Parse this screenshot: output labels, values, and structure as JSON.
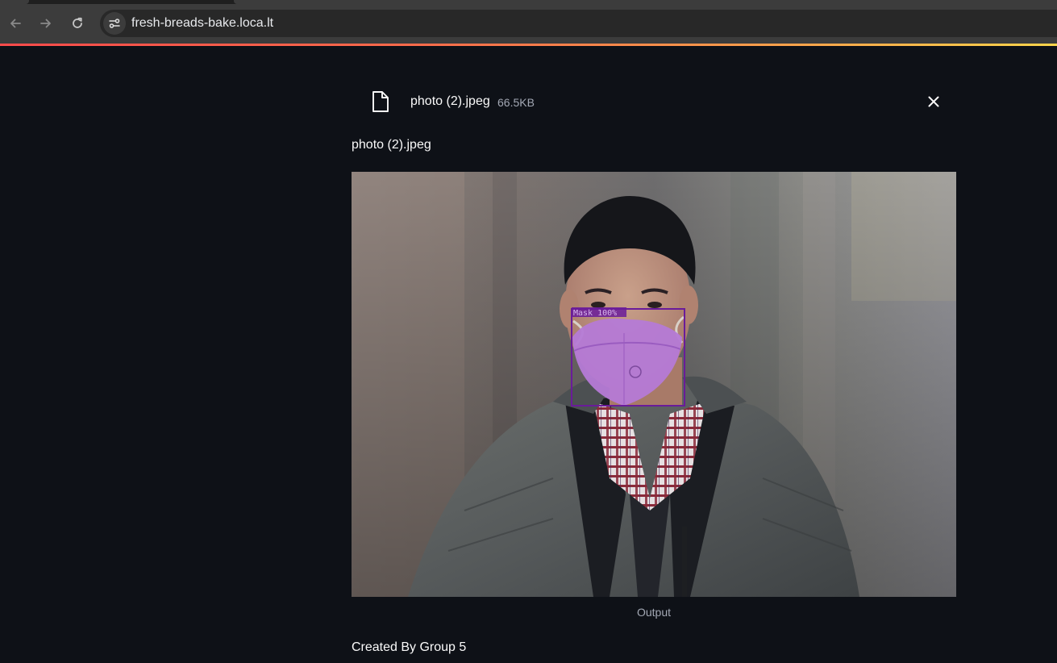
{
  "browser": {
    "url": "fresh-breads-bake.loca.lt"
  },
  "upload": {
    "file_name": "photo (2).jpeg",
    "file_size": "66.5KB"
  },
  "image_block": {
    "label": "photo (2).jpeg",
    "detection_label": "Mask 100%",
    "caption": "Output"
  },
  "footer": {
    "text": "Created By Group 5"
  },
  "colors": {
    "background": "#0e1117",
    "detection_box": "#6a1b9a",
    "mask_fill": "#b57ad6",
    "progress_start": "#ff4b4b",
    "progress_end": "#ffd54b"
  }
}
